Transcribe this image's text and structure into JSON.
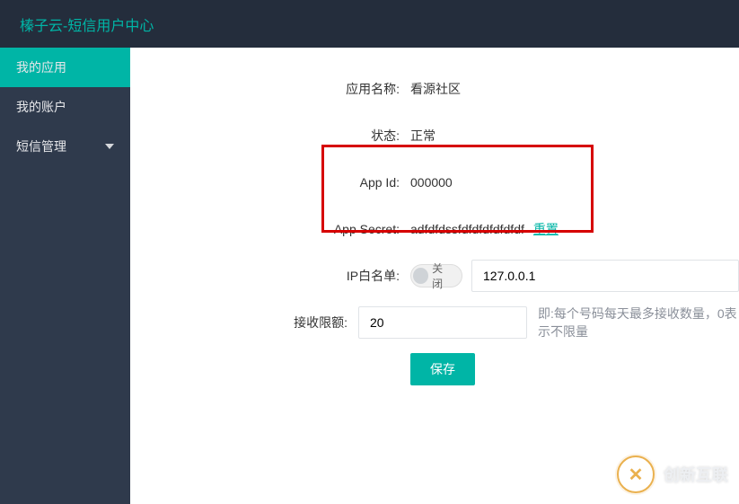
{
  "header": {
    "title": "榛子云-短信用户中心"
  },
  "sidebar": {
    "items": [
      {
        "label": "我的应用",
        "active": true
      },
      {
        "label": "我的账户",
        "active": false
      },
      {
        "label": "短信管理",
        "active": false,
        "has_children": true
      }
    ]
  },
  "form": {
    "app_name": {
      "label": "应用名称:",
      "value": "看源社区"
    },
    "status": {
      "label": "状态:",
      "value": "正常"
    },
    "app_id": {
      "label": "App Id:",
      "value": "000000"
    },
    "app_secret": {
      "label": "App Secret:",
      "value": "adfdfdssfdfdfdfdfdfdf",
      "reset": "重置"
    },
    "ip_whitelist": {
      "label": "IP白名单:",
      "toggle": "关闭",
      "value": "127.0.0.1"
    },
    "recv_limit": {
      "label": "接收限额:",
      "value": "20",
      "hint": "即:每个号码每天最多接收数量，0表示不限量"
    },
    "save": "保存"
  },
  "branding": {
    "logo_mark": "✕",
    "logo_text": "创新互联"
  }
}
